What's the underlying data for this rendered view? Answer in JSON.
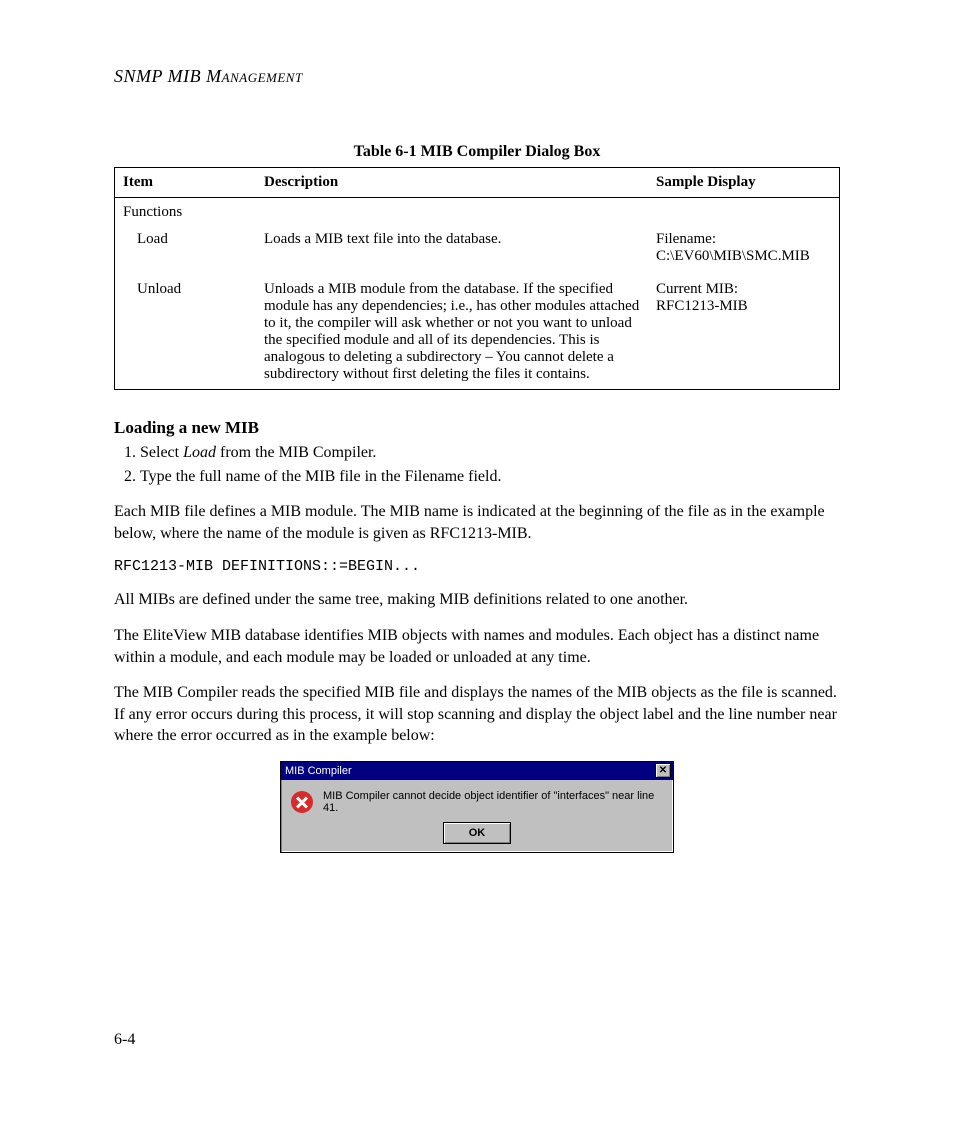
{
  "header": {
    "running_head": "SNMP MIB Management"
  },
  "table": {
    "caption": "Table 6-1  MIB Compiler Dialog Box",
    "headers": {
      "c1": "Item",
      "c2": "Description",
      "c3": "Sample Display"
    },
    "rows": {
      "functions": {
        "item": "Functions",
        "desc": "",
        "sample": ""
      },
      "load": {
        "item": "Load",
        "desc": "Loads a MIB text file into the database.",
        "sample_l1": "Filename:",
        "sample_l2": "C:\\EV60\\MIB\\SMC.MIB"
      },
      "unload": {
        "item": "Unload",
        "desc": "Unloads a MIB module from the database. If the specified module has any dependencies; i.e., has other modules attached to it, the compiler will ask whether or not you want to unload the specified module and all of its dependencies. This is analogous to deleting a subdirectory – You cannot delete a subdirectory without first deleting the files it contains.",
        "sample_l1": "Current MIB:",
        "sample_l2": "RFC1213-MIB"
      }
    }
  },
  "section": {
    "heading": "Loading a new MIB",
    "step1_pre": "Select ",
    "step1_em": "Load",
    "step1_post": " from the MIB Compiler.",
    "step2": "Type the full name of the MIB file in the Filename field."
  },
  "paragraphs": {
    "p1": "Each MIB file defines a MIB module. The MIB name is indicated at the beginning of the file as in the example below, where the name of the module is given as RFC1213-MIB.",
    "code": "RFC1213-MIB DEFINITIONS::=BEGIN...",
    "p2": "All MIBs are defined under the same tree, making MIB definitions related to one another.",
    "p3": "The EliteView MIB database identifies MIB objects with names and modules. Each object has a distinct name within a module, and each module may be loaded or unloaded at any time.",
    "p4": "The MIB Compiler reads the specified MIB file and displays the names of the MIB objects as the file is scanned. If any error occurs during this process, it will stop scanning and display the object label and the line number near where the error occurred as in the example below:"
  },
  "dialog": {
    "title": "MIB Compiler",
    "message": "MIB Compiler cannot decide object identifier of \"interfaces\" near line 41.",
    "ok": "OK"
  },
  "page_number": "6-4"
}
